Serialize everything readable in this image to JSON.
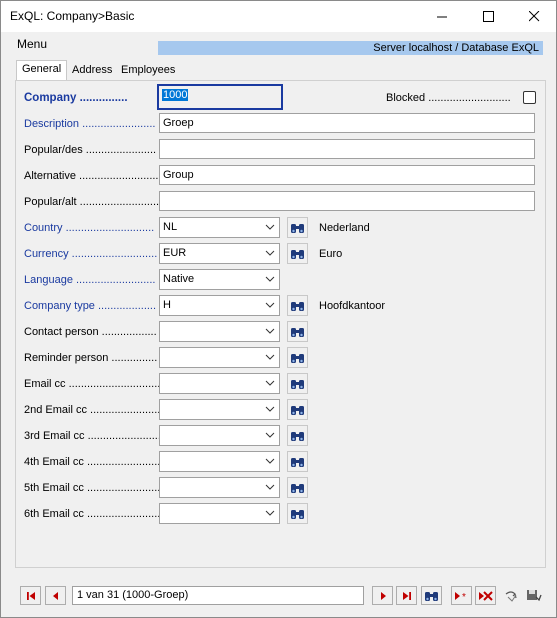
{
  "window": {
    "title": "ExQL: Company>Basic"
  },
  "menu": {
    "label": "Menu",
    "server_info": "Server localhost / Database ExQL"
  },
  "tabs": [
    {
      "label": "General",
      "active": true
    },
    {
      "label": "Address",
      "active": false
    },
    {
      "label": "Employees",
      "active": false
    }
  ],
  "form": {
    "company": {
      "label": "Company ...............",
      "value": "1000"
    },
    "blocked": {
      "label": "Blocked ...........................",
      "checked": false
    },
    "description": {
      "label": "Description ........................",
      "value": "Groep"
    },
    "popular_des": {
      "label": "Popular/des .......................",
      "value": ""
    },
    "alternative": {
      "label": "Alternative ..........................",
      "value": "Group"
    },
    "popular_alt": {
      "label": "Popular/alt ...........................",
      "value": ""
    },
    "country": {
      "label": "Country .............................",
      "value": "NL",
      "desc": "Nederland"
    },
    "currency": {
      "label": "Currency ............................",
      "value": "EUR",
      "desc": "Euro"
    },
    "language": {
      "label": "Language ..........................",
      "value": "Native"
    },
    "company_type": {
      "label": "Company type ...................",
      "value": "H",
      "desc": "Hoofdkantoor"
    },
    "contact_person": {
      "label": "Contact person ..................",
      "value": ""
    },
    "reminder_person": {
      "label": "Reminder person ...............",
      "value": ""
    },
    "email_cc": {
      "label": "Email cc ..............................",
      "value": ""
    },
    "email_cc_2": {
      "label": "2nd Email cc .......................",
      "value": ""
    },
    "email_cc_3": {
      "label": "3rd Email cc ........................",
      "value": ""
    },
    "email_cc_4": {
      "label": "4th Email cc ........................",
      "value": ""
    },
    "email_cc_5": {
      "label": "5th Email cc ........................",
      "value": ""
    },
    "email_cc_6": {
      "label": "6th Email cc ........................",
      "value": ""
    }
  },
  "footer": {
    "record": "1 van 31 (1000-Groep)"
  },
  "colors": {
    "label_blue": "#1a3aa0",
    "server_bar": "#a6c8ee",
    "nav_red": "#c00000"
  }
}
